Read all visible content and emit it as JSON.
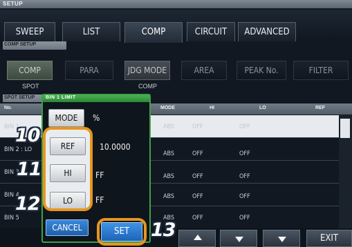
{
  "header": {
    "setup": "SETUP"
  },
  "tabs": [
    "SWEEP",
    "LIST",
    "COMP",
    "CIRCUIT",
    "ADVANCED"
  ],
  "comp_setup": {
    "title": "COMP SETUP",
    "buttons": [
      "COMP",
      "PARA",
      "JDG MODE",
      "AREA",
      "PEAK No.",
      "FILTER"
    ],
    "captions": {
      "spot": "SPOT",
      "comp": "COMP"
    }
  },
  "spot_setup": {
    "title": "SPOT SETUP"
  },
  "table": {
    "headers": {
      "no": "No.",
      "mode": "MODE",
      "hi": "HI",
      "lo": "LO",
      "ref": "REF"
    },
    "rows": [
      {
        "label": "BIN 1",
        "mode": "ABS",
        "hi": "OFF",
        "lo": "OFF"
      },
      {
        "label": "BIN 2 : LO",
        "mode": "ABS",
        "hi": "OFF",
        "lo": "OFF"
      },
      {
        "label": "BIN 3",
        "mode": "ABS",
        "hi": "OFF",
        "lo": "OFF"
      },
      {
        "label": "BIN 4",
        "mode": "ABS",
        "hi": "OFF",
        "lo": "OFF"
      },
      {
        "label": "BIN 5",
        "mode": "ABS",
        "hi": "OFF",
        "lo": "OFF"
      }
    ]
  },
  "dialog": {
    "title": "BIN 1 LIMIT",
    "mode_button": "MODE",
    "mode_value": "%",
    "ref_button": "REF",
    "ref_value": "10.0000",
    "hi_button": "HI",
    "hi_value": "FF",
    "lo_button": "LO",
    "lo_value": "FF",
    "cancel": "CANCEL",
    "set": "SET"
  },
  "footer": {
    "exit": "EXIT"
  },
  "callouts": {
    "c10": "10",
    "c11": "11",
    "c12": "12",
    "c13": "13"
  },
  "colors": {
    "dialog_border": "#3fa148",
    "callout": "#e7961f",
    "set_button": "#1d64b8"
  }
}
